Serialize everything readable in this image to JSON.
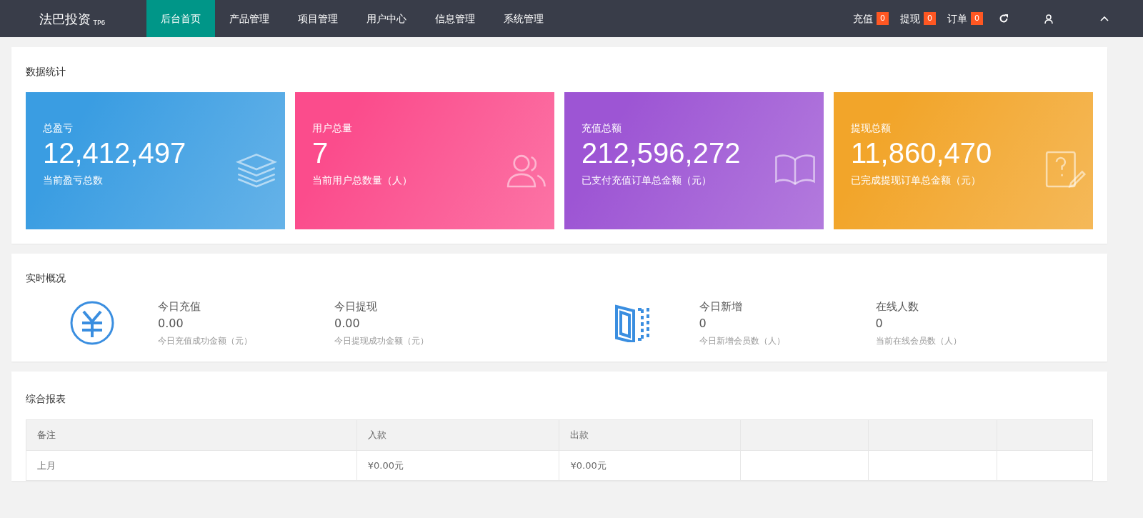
{
  "brand": {
    "name": "法巴投资",
    "tag": "TP6"
  },
  "nav": [
    {
      "label": "后台首页",
      "selected": true
    },
    {
      "label": "产品管理",
      "selected": false
    },
    {
      "label": "项目管理",
      "selected": false
    },
    {
      "label": "用户中心",
      "selected": false
    },
    {
      "label": "信息管理",
      "selected": false
    },
    {
      "label": "系统管理",
      "selected": false
    }
  ],
  "counters": [
    {
      "label": "充值",
      "count": "0"
    },
    {
      "label": "提现",
      "count": "0"
    },
    {
      "label": "订单",
      "count": "0"
    }
  ],
  "stats": {
    "title": "数据统计",
    "cards": [
      {
        "label": "总盈亏",
        "value": "12,412,497",
        "note": "当前盈亏总数",
        "color": "#3a9de2"
      },
      {
        "label": "用户总量",
        "value": "7",
        "note": "当前用户总数量（人）",
        "color": "#fb4c8c"
      },
      {
        "label": "充值总额",
        "value": "212,596,272",
        "note": "已支付充值订单总金额（元）",
        "color": "#9d55d4"
      },
      {
        "label": "提现总额",
        "value": "11,860,470",
        "note": "已完成提现订单总金额（元）",
        "color": "#f2a52a"
      }
    ]
  },
  "realtime": {
    "title": "实时概况",
    "groups": [
      {
        "items": [
          {
            "label": "今日充值",
            "value": "0.00",
            "note": "今日充值成功金额（元）"
          },
          {
            "label": "今日提现",
            "value": "0.00",
            "note": "今日提现成功金额（元）"
          }
        ]
      },
      {
        "items": [
          {
            "label": "今日新增",
            "value": "0",
            "note": "今日新增会员数（人）"
          },
          {
            "label": "在线人数",
            "value": "0",
            "note": "当前在线会员数（人）"
          }
        ]
      }
    ]
  },
  "report": {
    "title": "综合报表",
    "columns": [
      "备注",
      "入款",
      "出款",
      "",
      "",
      ""
    ],
    "rows": [
      [
        "上月",
        "¥0.00元",
        "¥0.00元",
        "",
        "",
        ""
      ]
    ]
  }
}
